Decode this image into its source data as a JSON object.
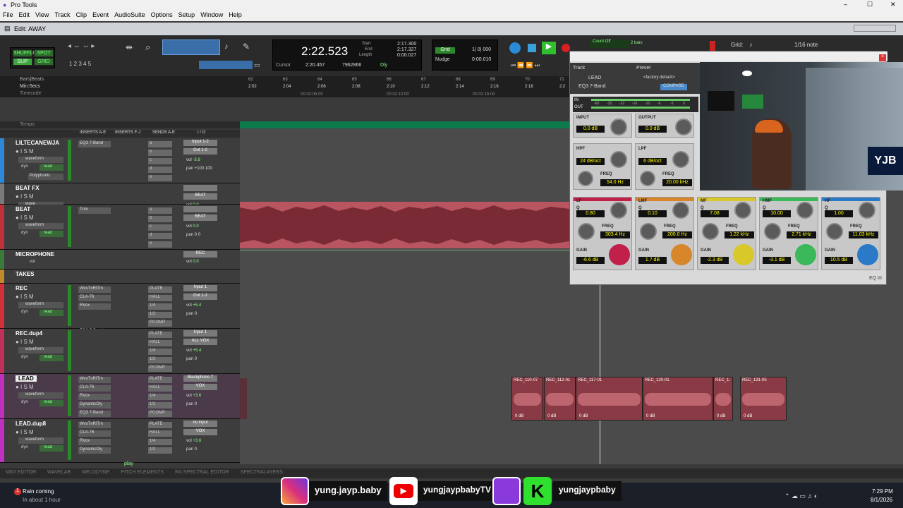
{
  "app": {
    "title": "Pro Tools",
    "window_title": "Edit: AWAY"
  },
  "menu": [
    "File",
    "Edit",
    "View",
    "Track",
    "Clip",
    "Event",
    "AudioSuite",
    "Options",
    "Setup",
    "Window",
    "Help"
  ],
  "modes": {
    "shuffle": "SHUFFLE",
    "spot": "SPOT",
    "slip": "SLIP",
    "grid": "GRID"
  },
  "counter": {
    "main": "2:22.523",
    "start_label": "Start",
    "end_label": "End",
    "length_label": "Length",
    "start": "2:17.300",
    "end": "2:17.327",
    "length": "0:00.027",
    "cursor_label": "Cursor",
    "cursor": "2:20.457",
    "samples": "7962866",
    "dly": "Dly"
  },
  "grid": {
    "label": "Grid",
    "value": "1| 0| 000",
    "nudge_label": "Nudge",
    "nudge": "0:00.010",
    "grid_right_label": "Grid:",
    "grid_right_value": "1/16 note",
    "count_off": "Count Off",
    "meter": "Meter",
    "bars": "2 bars",
    "meter_value": "4/4"
  },
  "ruler": {
    "barsbeats": "Bars|Beats",
    "minsecs": "Min:Secs",
    "timecode": "Timecode",
    "tempo": "Tempo",
    "bars": [
      "62",
      "63",
      "64",
      "65",
      "66",
      "67",
      "68",
      "69",
      "70",
      "71"
    ],
    "mins": [
      "2:02",
      "2:04",
      "2:06",
      "2:08",
      "2:10",
      "2:12",
      "2:14",
      "2:16",
      "2:18",
      "2:2"
    ],
    "tc": [
      "00:02:05:00",
      "00:02:10:00",
      "00:02:15:00"
    ]
  },
  "columns": {
    "inserts_ae": "INSERTS A-E",
    "inserts_fj": "INSERTS F-J",
    "sends_ae": "SENDS A-E",
    "io": "I / O"
  },
  "tracks": [
    {
      "name": "LILTECANEWJA",
      "view": "waveform",
      "dyn": "dyn",
      "read": "read",
      "extra": "Polyphonic",
      "inserts": [
        "EQ3 7-Band"
      ],
      "sends": [
        "a",
        "b",
        "c",
        "d",
        "e"
      ],
      "io_in": "Input 1-2",
      "io_out": "Out 1-2",
      "vol": "-3.8",
      "pan": "+100  100"
    },
    {
      "name": "BEAT FX",
      "view": "wave",
      "read": "read",
      "inserts": [],
      "io_in": "",
      "io_out": "BEAT",
      "vol": "0.0",
      "pan": "P  P"
    },
    {
      "name": "BEAT",
      "view": "waveform",
      "dyn": "dyn",
      "read": "read",
      "inserts": [
        "Trim"
      ],
      "sends": [
        "a",
        "b",
        "c",
        "d",
        "e"
      ],
      "io_in": "",
      "io_out": "BEAT",
      "vol": "0.0",
      "pan": "0  0"
    },
    {
      "name": "MICROPHONE",
      "view": "vol",
      "read": "read",
      "io_out": "REC",
      "vol": "0.0"
    },
    {
      "name": "TAKES",
      "view": "",
      "read": ""
    },
    {
      "name": "REC",
      "view": "waveform",
      "dyn": "dyn",
      "read": "read",
      "inserts": [
        "WvsTnRlTm",
        "CLA-76",
        "RVox",
        "",
        "",
        "EQ3 7-Band"
      ],
      "sends": [
        "PLATE",
        "HALL",
        "1/4",
        "1/2",
        "PCOMP"
      ],
      "io_in": "Input 1",
      "io_out": "Out 1-2",
      "vol": "+5.4",
      "pan": "0"
    },
    {
      "name": "REC.dup4",
      "view": "waveform",
      "dyn": "dyn",
      "read": "read",
      "inserts": [],
      "sends": [
        "PLATE",
        "HALL",
        "1/4",
        "1/2",
        "PCOMP"
      ],
      "io_in": "Input 1",
      "io_out": "ALL VOX",
      "vol": "+5.4",
      "pan": "0"
    },
    {
      "name": "LEAD",
      "view": "waveform",
      "dyn": "dyn",
      "read": "read",
      "inserts": [
        "WvsTnRlTm",
        "CLA-76",
        "RVox",
        "DynamicDly",
        "EQ3 7-Band"
      ],
      "sends": [
        "PLATE",
        "HALL",
        "1/4",
        "1/2",
        "PCOMP"
      ],
      "io_in": "Blackphone 7",
      "io_out": "VOX",
      "vol": "+3.6",
      "pan": "0"
    },
    {
      "name": "LEAD.dup8",
      "view": "waveform",
      "dyn": "dyn",
      "read": "read",
      "inserts": [
        "WvsTnRlTm",
        "CLA-76",
        "RVox",
        "DynamicDly"
      ],
      "sends": [
        "PLATE",
        "HALL",
        "1/4",
        "1/2"
      ],
      "io_in": "no input",
      "io_out": "VOX",
      "vol": "+3.6",
      "pan": "0"
    }
  ],
  "regions": [
    {
      "name": "REC_110-07",
      "gain": "0 dB"
    },
    {
      "name": "REC_112-01",
      "gain": "0 dB"
    },
    {
      "name": "REC_117-01",
      "gain": "0 dB"
    },
    {
      "name": "REC_120-01",
      "gain": "0 dB"
    },
    {
      "name": "REC_1:",
      "gain": "0 dB"
    },
    {
      "name": "REC_131-05",
      "gain": "0 dB"
    }
  ],
  "plugin": {
    "track_label": "Track",
    "preset_label": "Preset",
    "track": "LEAD",
    "preset": "<factory default>",
    "insert": "EQ3 7-Band",
    "compare": "COMPARE",
    "in": "IN",
    "out": "OUT",
    "scale": [
      "-60",
      "-32",
      "-22",
      "-16",
      "-10",
      "-6",
      "-3",
      "0"
    ],
    "input_label": "INPUT",
    "input": "0.0 dB",
    "output_label": "OUTPUT",
    "output": "0.0 dB",
    "hpf_label": "HPF",
    "hpf_slope": "24 dB/oct",
    "hpf_freq": "54.0 Hz",
    "lpf_label": "LPF",
    "lpf_slope": "6 dB/oct",
    "lpf_freq": "20.00 kHz",
    "freq": "FREQ",
    "gain": "GAIN",
    "q": "Q",
    "bands": [
      {
        "name": "LF",
        "q": "0.80",
        "freq": "303.4 Hz",
        "gain": "-6.6 dB",
        "color": "#c0204a"
      },
      {
        "name": "LMF",
        "q": "0.10",
        "freq": "200.0 Hz",
        "gain": "1.7 dB",
        "color": "#d8862a"
      },
      {
        "name": "MF",
        "q": "7.08",
        "freq": "1.22 kHz",
        "gain": "-2.3 dB",
        "color": "#d8c82a"
      },
      {
        "name": "HMF",
        "q": "10.00",
        "freq": "2.71 kHz",
        "gain": "-3.1 dB",
        "color": "#3ab85a"
      },
      {
        "name": "HF",
        "q": "1.00",
        "freq": "11.03 kHz",
        "gain": "10.5 dB",
        "color": "#2a7ac8"
      }
    ],
    "eq_graph_labels": [
      "20",
      "50",
      "100",
      "200",
      "500",
      "1k",
      "2k",
      "5k",
      "10k",
      "20k"
    ],
    "badge": "EQ III"
  },
  "bottom_tabs": [
    "MIDI EDITOR",
    "WAVELAB",
    "MELODYNE",
    "PITCH ELEMENTS",
    "RX SPECTRAL EDITOR",
    "SPECTRALAYERS"
  ],
  "play_label": "play",
  "socials": {
    "instagram": "yung.jayp.baby",
    "youtube": "yungjaypbabyTV",
    "kick": "yungjaypbaby"
  },
  "taskbar": {
    "weather_title": "Rain coming",
    "weather_sub": "In about 1 hour",
    "time": "7:29 PM",
    "date": "8/1/2026"
  }
}
